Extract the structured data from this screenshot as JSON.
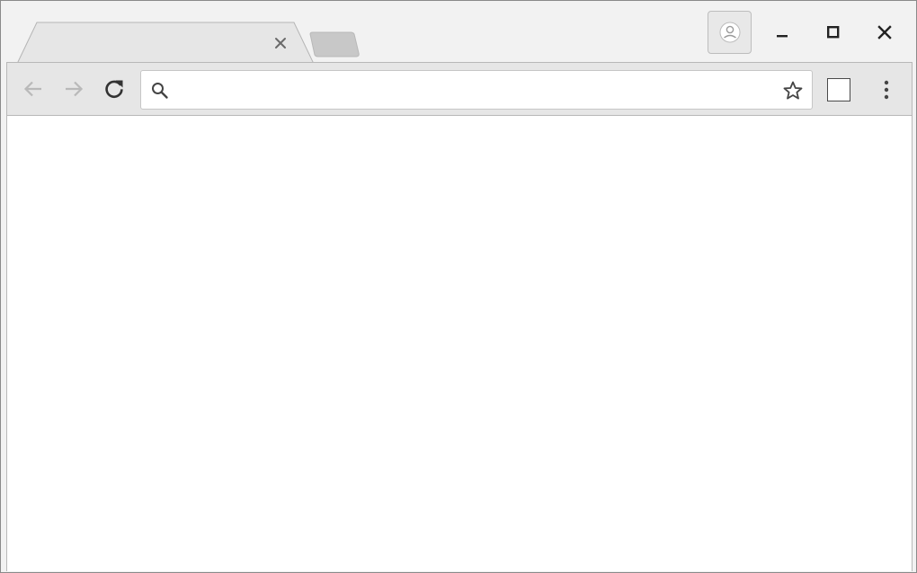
{
  "tab": {
    "title": "",
    "close_icon": "close-icon"
  },
  "new_tab": {
    "icon": "new-tab-icon"
  },
  "profile": {
    "icon": "avatar-icon"
  },
  "window_controls": {
    "minimize_icon": "minimize-icon",
    "maximize_icon": "maximize-icon",
    "close_icon": "close-icon"
  },
  "toolbar": {
    "back_icon": "arrow-left-icon",
    "forward_icon": "arrow-right-icon",
    "reload_icon": "reload-icon",
    "bookmark_icon": "star-icon",
    "extension_icon": "extension-square-icon",
    "menu_icon": "kebab-menu-icon"
  },
  "omnibox": {
    "value": "",
    "placeholder": "",
    "search_icon": "search-icon"
  },
  "page": {
    "content": ""
  },
  "colors": {
    "titlebar": "#f2f2f2",
    "toolbar": "#e6e6e6",
    "active_tab": "#e6e6e6",
    "inactive_tab": "#c8c8c8",
    "content": "#ffffff"
  }
}
